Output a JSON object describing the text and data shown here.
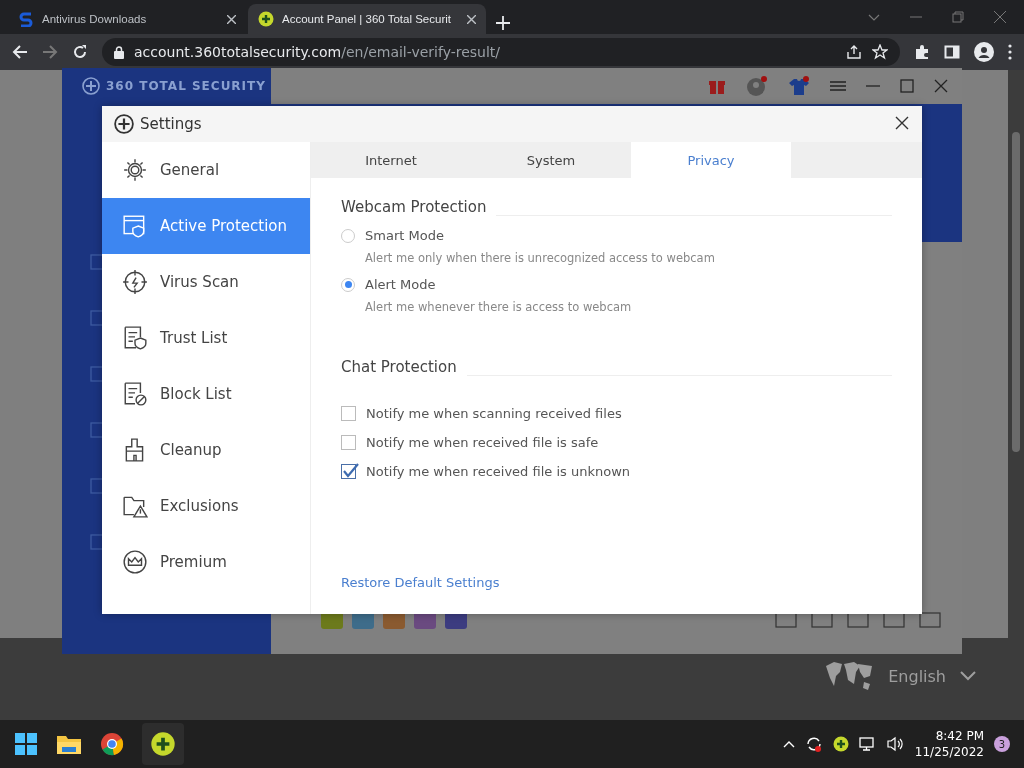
{
  "browser": {
    "tabs": [
      {
        "title": "Antivirus Downloads",
        "selected": false
      },
      {
        "title": "Account Panel | 360 Total Securit",
        "selected": true
      }
    ],
    "address": {
      "host": "account.360totalsecurity.com",
      "path": "/en/email-verify-result/"
    }
  },
  "app": {
    "brand": "360 TOTAL SECURITY"
  },
  "settings": {
    "title": "Settings",
    "nav": [
      {
        "label": "General",
        "selected": false
      },
      {
        "label": "Active Protection",
        "selected": true
      },
      {
        "label": "Virus Scan",
        "selected": false
      },
      {
        "label": "Trust List",
        "selected": false
      },
      {
        "label": "Block List",
        "selected": false
      },
      {
        "label": "Cleanup",
        "selected": false
      },
      {
        "label": "Exclusions",
        "selected": false
      },
      {
        "label": "Premium",
        "selected": false
      }
    ],
    "tabs": [
      {
        "label": "Internet",
        "selected": false
      },
      {
        "label": "System",
        "selected": false
      },
      {
        "label": "Privacy",
        "selected": true
      }
    ],
    "webcam": {
      "heading": "Webcam Protection",
      "options": [
        {
          "label": "Smart Mode",
          "description": "Alert me only when there is unrecognized access to webcam",
          "selected": false
        },
        {
          "label": "Alert Mode",
          "description": "Alert me whenever there is access to webcam",
          "selected": true
        }
      ]
    },
    "chat": {
      "heading": "Chat Protection",
      "options": [
        {
          "label": "Notify me when scanning received files",
          "checked": false
        },
        {
          "label": "Notify me when received file is safe",
          "checked": false
        },
        {
          "label": "Notify me when received file is unknown",
          "checked": true
        }
      ]
    },
    "restore_link": "Restore Default Settings"
  },
  "footer": {
    "language": "English"
  },
  "taskbar": {
    "time": "8:42 PM",
    "date": "11/25/2022",
    "notification_count": "3"
  }
}
